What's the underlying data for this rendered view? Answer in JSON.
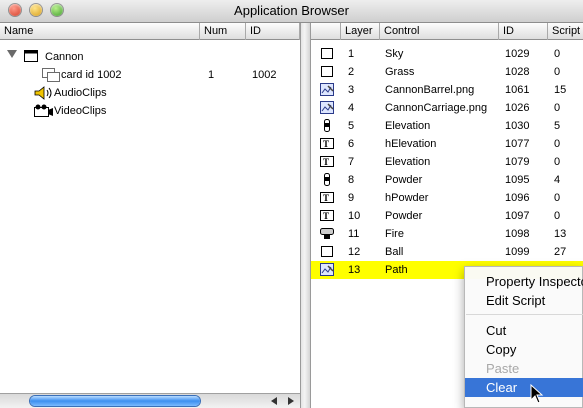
{
  "window": {
    "title": "Application Browser"
  },
  "left_pane": {
    "columns": [
      "Name",
      "Num",
      "ID"
    ],
    "tree": {
      "stack_name": "Cannon",
      "card": {
        "name": "card id 1002",
        "num": "1",
        "id": "1002"
      },
      "audio": "AudioClips",
      "video": "VideoClips"
    }
  },
  "right_pane": {
    "columns": [
      "Layer",
      "Control",
      "ID",
      "Script"
    ],
    "rows": [
      {
        "icon": "rectangle-icon",
        "layer": "1",
        "control": "Sky",
        "id": "1029",
        "script": "0"
      },
      {
        "icon": "rectangle-icon",
        "layer": "2",
        "control": "Grass",
        "id": "1028",
        "script": "0"
      },
      {
        "icon": "image-icon",
        "layer": "3",
        "control": "CannonBarrel.png",
        "id": "1061",
        "script": "15"
      },
      {
        "icon": "image-icon",
        "layer": "4",
        "control": "CannonCarriage.png",
        "id": "1026",
        "script": "0"
      },
      {
        "icon": "scrollbar-icon",
        "layer": "5",
        "control": "Elevation",
        "id": "1030",
        "script": "5"
      },
      {
        "icon": "text-field-icon",
        "layer": "6",
        "control": "hElevation",
        "id": "1077",
        "script": "0"
      },
      {
        "icon": "text-field-icon",
        "layer": "7",
        "control": "Elevation",
        "id": "1079",
        "script": "0"
      },
      {
        "icon": "scrollbar-icon",
        "layer": "8",
        "control": "Powder",
        "id": "1095",
        "script": "4"
      },
      {
        "icon": "text-field-icon",
        "layer": "9",
        "control": "hPowder",
        "id": "1096",
        "script": "0"
      },
      {
        "icon": "text-field-icon",
        "layer": "10",
        "control": "Powder",
        "id": "1097",
        "script": "0"
      },
      {
        "icon": "button-icon",
        "layer": "11",
        "control": "Fire",
        "id": "1098",
        "script": "13"
      },
      {
        "icon": "rectangle-icon",
        "layer": "12",
        "control": "Ball",
        "id": "1099",
        "script": "27"
      },
      {
        "icon": "image-icon",
        "layer": "13",
        "control": "Path",
        "id": "",
        "script": ""
      }
    ],
    "selected_row": 12,
    "selected_color": "#ffff00"
  },
  "context_menu": {
    "items": [
      {
        "label": "Property Inspector",
        "state": "normal"
      },
      {
        "label": "Edit Script",
        "state": "normal"
      },
      {
        "label": "Cut",
        "state": "normal"
      },
      {
        "label": "Copy",
        "state": "normal"
      },
      {
        "label": "Paste",
        "state": "disabled"
      },
      {
        "label": "Clear",
        "state": "highlighted"
      }
    ],
    "highlight_color": "#3875d7"
  }
}
